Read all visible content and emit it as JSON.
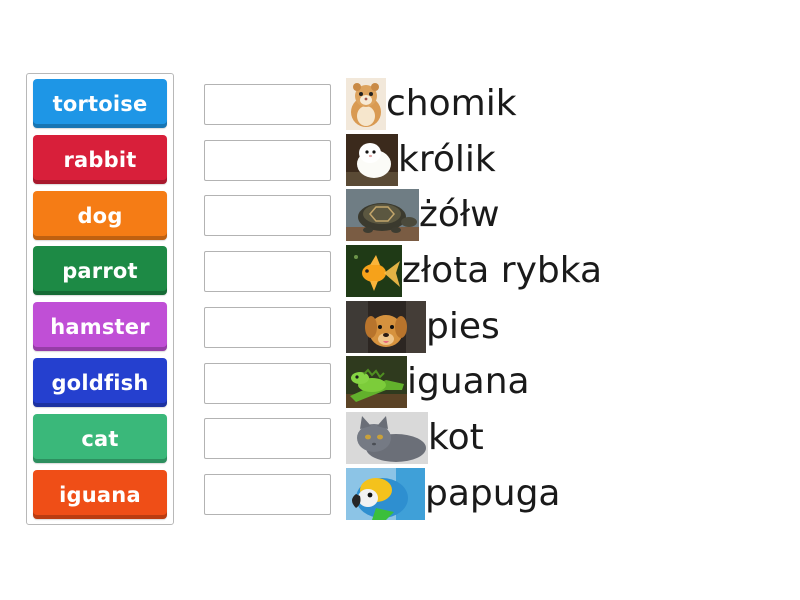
{
  "tiles": [
    {
      "label": "tortoise",
      "color": "#1e96e6"
    },
    {
      "label": "rabbit",
      "color": "#d81f3a"
    },
    {
      "label": "dog",
      "color": "#f57c15"
    },
    {
      "label": "parrot",
      "color": "#1d8a45"
    },
    {
      "label": "hamster",
      "color": "#c04fd6"
    },
    {
      "label": "goldfish",
      "color": "#2540cf"
    },
    {
      "label": "cat",
      "color": "#3ab87a"
    },
    {
      "label": "iguana",
      "color": "#ef4e17"
    }
  ],
  "items": [
    {
      "word": "chomik",
      "icon": "hamster-photo"
    },
    {
      "word": "królik",
      "icon": "rabbit-photo"
    },
    {
      "word": "żółw",
      "icon": "tortoise-photo"
    },
    {
      "word": "złota rybka",
      "icon": "goldfish-photo"
    },
    {
      "word": "pies",
      "icon": "dog-photo"
    },
    {
      "word": "iguana",
      "icon": "iguana-photo"
    },
    {
      "word": "kot",
      "icon": "cat-photo"
    },
    {
      "word": "papuga",
      "icon": "parrot-photo"
    }
  ]
}
